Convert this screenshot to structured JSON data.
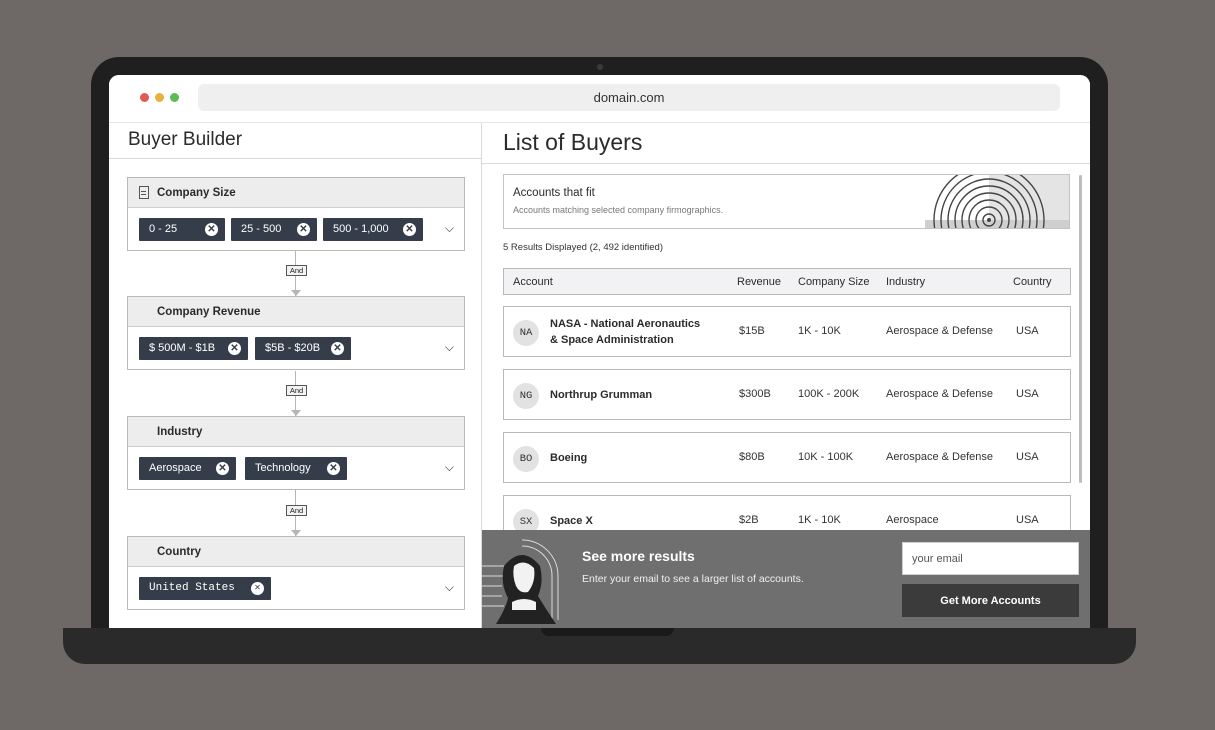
{
  "browser": {
    "url": "domain.com"
  },
  "builder": {
    "title": "Buyer Builder",
    "connector_label": "And",
    "filters": [
      {
        "name": "Company Size",
        "icon": "building-icon",
        "chips": [
          "0 - 25",
          "25 - 500",
          "500 - 1,000"
        ]
      },
      {
        "name": "Company Revenue",
        "chips": [
          "$ 500M - $1B",
          "$5B - $20B"
        ]
      },
      {
        "name": "Industry",
        "chips": [
          "Aerospace",
          "Technology"
        ]
      },
      {
        "name": "Country",
        "chips": [
          "United States"
        ]
      }
    ]
  },
  "buyers": {
    "title": "List of Buyers",
    "fit_card": {
      "title": "Accounts that fit",
      "subtitle": "Accounts matching selected company firmographics."
    },
    "results_count": "5  Results Displayed  (2, 492  identified)",
    "columns": [
      "Account",
      "Revenue",
      "Company Size",
      "Industry",
      "Country"
    ],
    "rows": [
      {
        "initials": "NA",
        "name_line1": "NASA - National Aeronautics",
        "name_line2": "& Space Administration",
        "revenue": "$15B",
        "size": "1K - 10K",
        "industry": "Aerospace & Defense",
        "country": "USA"
      },
      {
        "initials": "NG",
        "name_line1": "Northrup Grumman",
        "name_line2": "",
        "revenue": "$300B",
        "size": "100K - 200K",
        "industry": "Aerospace & Defense",
        "country": "USA"
      },
      {
        "initials": "BO",
        "name_line1": "Boeing",
        "name_line2": "",
        "revenue": "$80B",
        "size": "10K - 100K",
        "industry": "Aerospace & Defense",
        "country": "USA"
      },
      {
        "initials": "SX",
        "name_line1": "Space X",
        "name_line2": "",
        "revenue": "$2B",
        "size": "1K - 10K",
        "industry": "Aerospace",
        "country": "USA"
      }
    ]
  },
  "cta": {
    "title": "See more results",
    "subtitle": "Enter your email to see a larger list of accounts.",
    "email_placeholder": "your email",
    "button_label": "Get More Accounts"
  },
  "colors": {
    "chip_bg": "#363d4a",
    "cta_bg": "#6f6f6f",
    "button_bg": "#3b3b3b",
    "backdrop": "#6e6867"
  }
}
